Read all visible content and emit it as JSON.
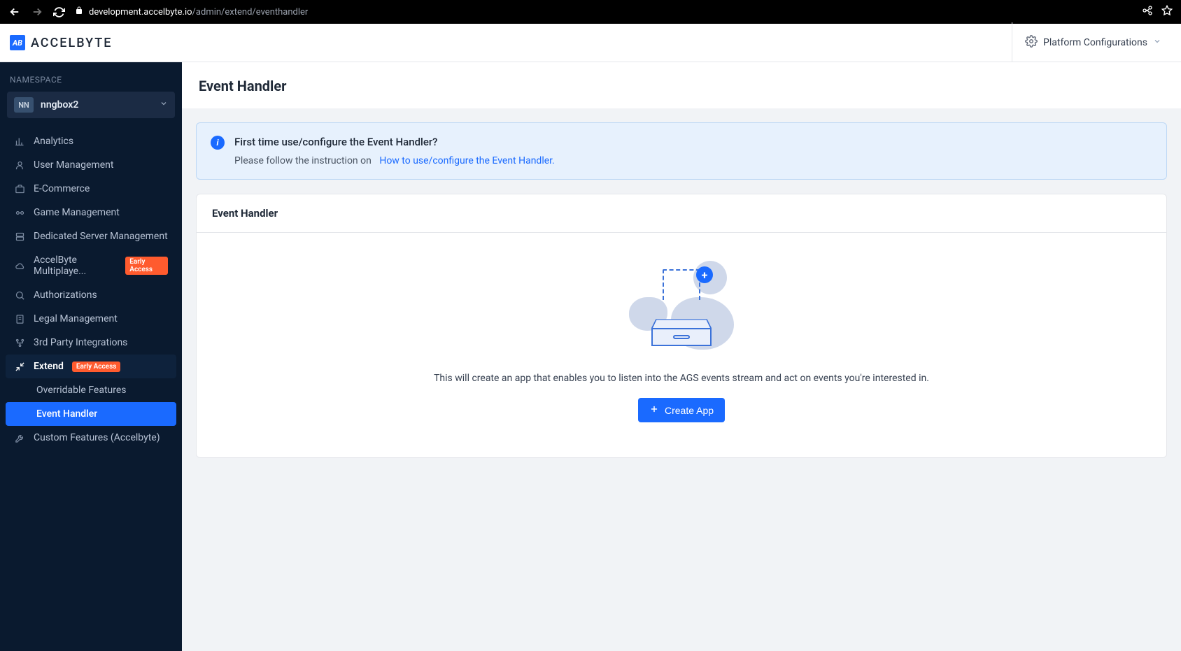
{
  "browser": {
    "url_host": "development.accelbyte.io",
    "url_path": "/admin/extend/eventhandler"
  },
  "brand": {
    "logo_text": "AB",
    "name": "ACCELBYTE"
  },
  "header": {
    "platform_configurations": "Platform Configurations"
  },
  "sidebar": {
    "namespace_label": "NAMESPACE",
    "namespace_badge": "NN",
    "namespace_name": "nngbox2",
    "items": [
      {
        "label": "Analytics",
        "icon": "analytics-icon"
      },
      {
        "label": "User Management",
        "icon": "user-icon"
      },
      {
        "label": "E-Commerce",
        "icon": "store-icon"
      },
      {
        "label": "Game Management",
        "icon": "game-icon"
      },
      {
        "label": "Dedicated Server Management",
        "icon": "server-icon"
      },
      {
        "label": "AccelByte Multiplaye...",
        "icon": "cloud-icon",
        "badge": "Early Access"
      },
      {
        "label": "Authorizations",
        "icon": "key-icon"
      },
      {
        "label": "Legal Management",
        "icon": "legal-icon"
      },
      {
        "label": "3rd Party Integrations",
        "icon": "integration-icon"
      },
      {
        "label": "Extend",
        "icon": "extend-icon",
        "badge": "Early Access",
        "active_parent": true
      },
      {
        "label": "Custom Features (Accelbyte)",
        "icon": "wrench-icon"
      }
    ],
    "sub_items": [
      {
        "label": "Overridable Features",
        "active": false
      },
      {
        "label": "Event Handler",
        "active": true
      }
    ]
  },
  "page": {
    "title": "Event Handler",
    "info_title": "First time use/configure the Event Handler?",
    "info_sub_prefix": "Please follow the instruction on",
    "info_link": "How to use/configure the Event Handler.",
    "card_header": "Event Handler",
    "empty_text": "This will create an app that enables you to listen into the AGS events stream and act on events you're interested in.",
    "create_btn": "Create App"
  }
}
